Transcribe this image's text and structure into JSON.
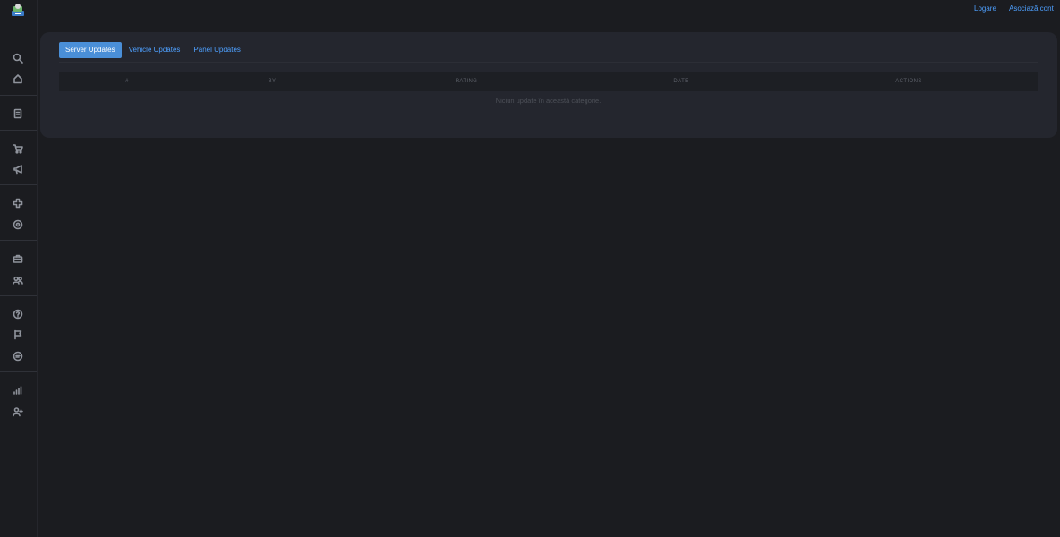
{
  "header": {
    "login_label": "Logare",
    "associate_label": "Asociază cont"
  },
  "sidebar": {
    "icons": [
      "search-icon",
      "home-icon",
      "document-icon",
      "cart-icon",
      "megaphone-icon",
      "puzzle-icon",
      "circle-icon",
      "toolbox-icon",
      "group-icon",
      "help-icon",
      "flag-icon",
      "chat-icon",
      "chart-icon",
      "user-add-icon"
    ]
  },
  "tabs": [
    {
      "label": "Server Updates",
      "active": true
    },
    {
      "label": "Vehicle Updates",
      "active": false
    },
    {
      "label": "Panel Updates",
      "active": false
    }
  ],
  "table": {
    "columns": [
      "#",
      "BY",
      "RATING",
      "DATE",
      "ACTIONS"
    ],
    "empty_text": "Niciun update în această categorie."
  },
  "colors": {
    "background": "#1b1c20",
    "panel": "#24262e",
    "accent": "#4ea0ff",
    "active_tab": "#4a8fd8"
  }
}
